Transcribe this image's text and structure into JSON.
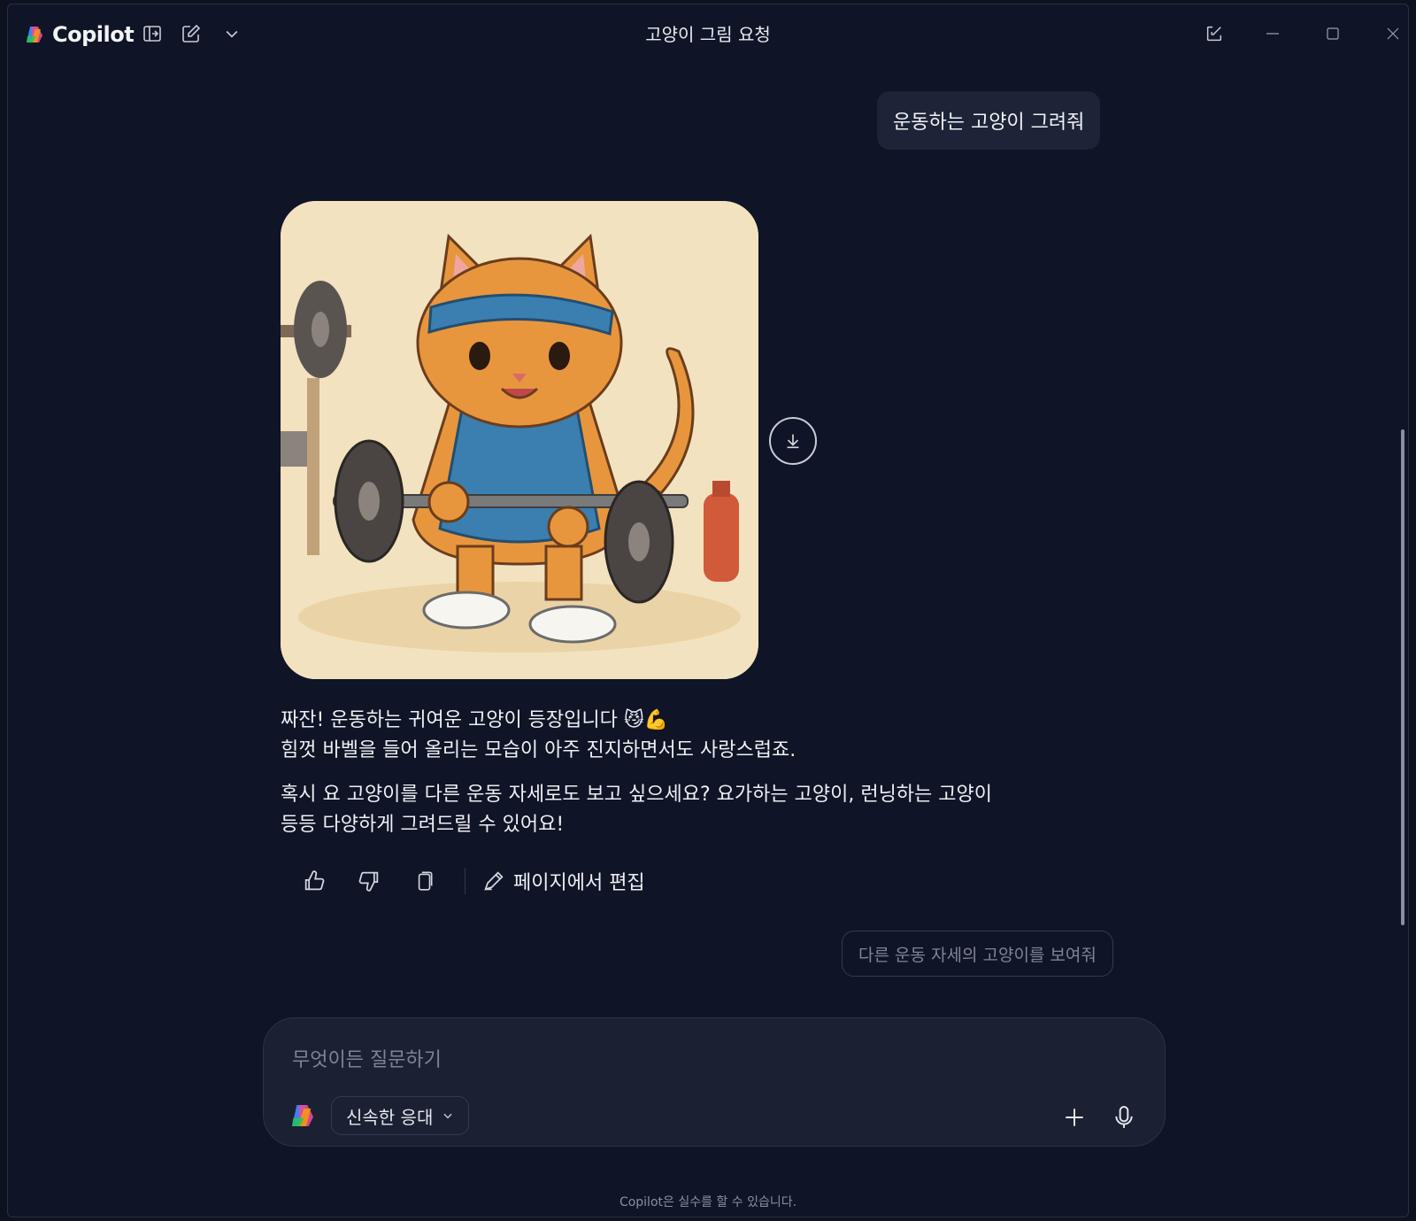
{
  "app": {
    "name": "Copilot",
    "title": "고양이 그림 요청"
  },
  "titlebar": {
    "icons": [
      "sidebar-toggle-icon",
      "new-chat-icon",
      "chevron-down-icon"
    ],
    "window_icons": [
      "popout-icon",
      "minimize-icon",
      "maximize-icon",
      "close-icon"
    ]
  },
  "conversation": {
    "user_message": "운동하는 고양이 그려줘",
    "image": {},
    "answer": {
      "line1": "짜잔! 운동하는 귀여운 고양이 등장입니다",
      "emoji": "😼💪",
      "line2": "힘껏 바벨을 들어 올리는 모습이 아주 진지하면서도 사랑스럽죠.",
      "para2_line1": "혹시 요 고양이를 다른 운동 자세로도 보고 싶으세요? 요가하는 고양이, 런닝하는 고양이",
      "para2_line2": "등등 다양하게 그려드릴 수 있어요!"
    },
    "actions": {
      "edit_label": "페이지에서 편집"
    },
    "suggestion": "다른 운동 자세의 고양이를 보여줘"
  },
  "composer": {
    "placeholder": "무엇이든 질문하기",
    "mode": "신속한 응대"
  },
  "footer": {
    "disclaimer": "Copilot은 실수를 할 수 있습니다."
  },
  "colors": {
    "background": "#0f1426",
    "bubble": "#1d2438",
    "composer": "#1b2133",
    "text": "#eef0f5",
    "muted": "#7f8596"
  }
}
